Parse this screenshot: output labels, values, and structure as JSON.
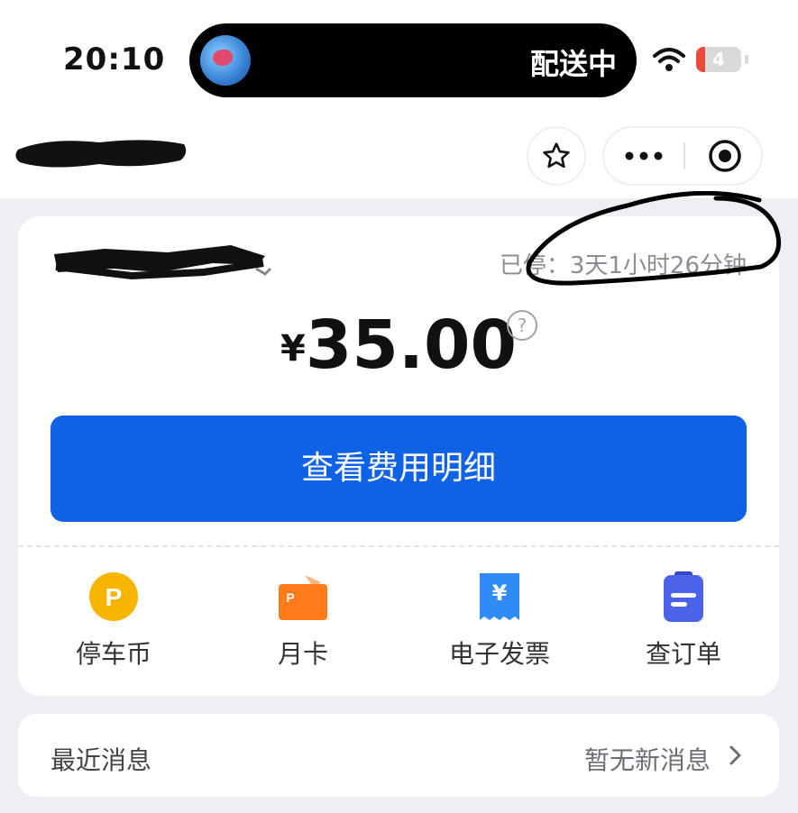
{
  "status_bar": {
    "time": "20:10",
    "live_activity_text": "配送中",
    "battery_level": "4"
  },
  "nav": {
    "icons": [
      "star-icon",
      "more-icon",
      "close-target-icon"
    ]
  },
  "parking": {
    "duration_text": "已停：3天1小时26分钟",
    "currency_symbol": "¥",
    "amount": "35.00",
    "help_icon": "?",
    "detail_button_label": "查看费用明细"
  },
  "services": [
    {
      "label": "停车币",
      "icon": "parking-coin-icon",
      "color": "#f7b500"
    },
    {
      "label": "月卡",
      "icon": "monthly-card-icon",
      "color": "#ff7a1a"
    },
    {
      "label": "电子发票",
      "icon": "e-invoice-icon",
      "color": "#2f8bf5"
    },
    {
      "label": "查订单",
      "icon": "orders-icon",
      "color": "#4a63e8"
    }
  ],
  "messages": {
    "title": "最近消息",
    "status": "暂无新消息"
  },
  "colors": {
    "primary": "#0f62e6",
    "page_background": "#edeff4"
  }
}
